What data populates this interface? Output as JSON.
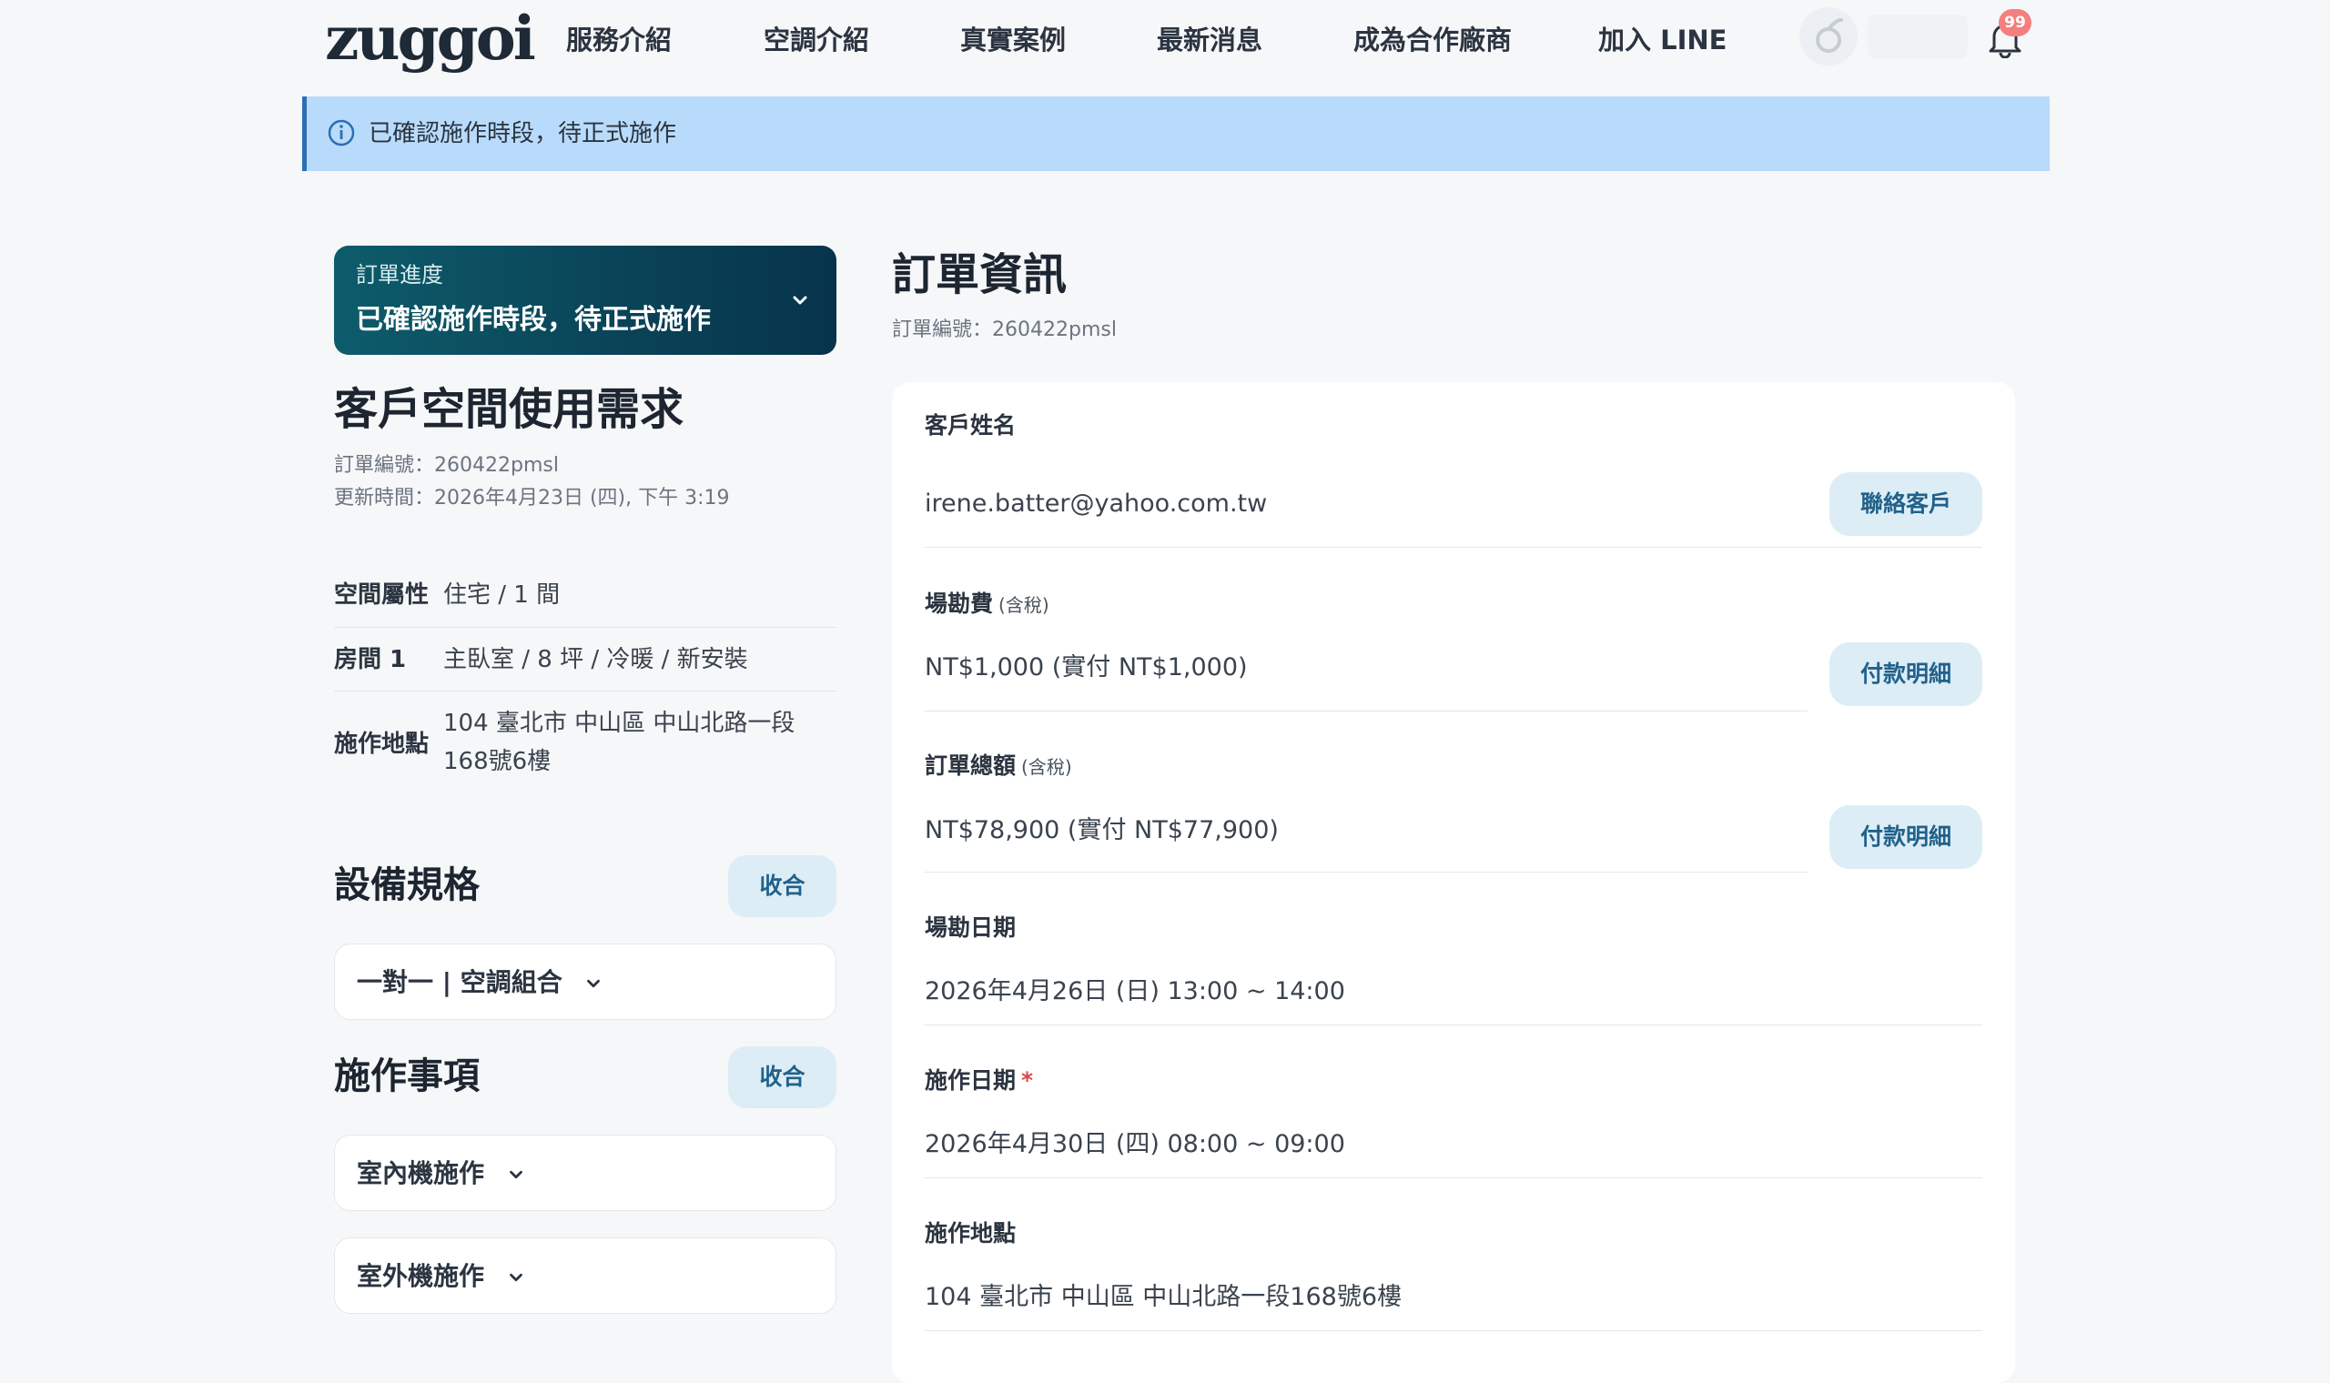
{
  "header": {
    "logo": "zuggoi",
    "nav": [
      {
        "label": "服務介紹"
      },
      {
        "label": "空調介紹"
      },
      {
        "label": "真實案例"
      },
      {
        "label": "最新消息"
      },
      {
        "label": "成為合作廠商"
      },
      {
        "label": "加入 LINE"
      }
    ],
    "notification_count": "99"
  },
  "banner": {
    "icon": "info-icon",
    "text": "已確認施作時段，待正式施作"
  },
  "progress": {
    "label": "訂單進度",
    "status": "已確認施作時段，待正式施作"
  },
  "space": {
    "title": "客戶空間使用需求",
    "order_no": "訂單編號：260422pmsl",
    "updated": "更新時間：2026年4月23日 (四), 下午 3:19",
    "rows": [
      {
        "key": "空間屬性",
        "value": "住宅 / 1 間"
      },
      {
        "key": "房間 1",
        "value": "主臥室 / 8 坪 / 冷暖 / 新安裝"
      },
      {
        "key": "施作地點",
        "value": "104 臺北市 中山區 中山北路一段168號6樓"
      }
    ]
  },
  "equipment": {
    "title": "設備規格",
    "collapse_label": "收合",
    "items": [
      {
        "label": "一對一 | 空調組合"
      }
    ]
  },
  "work": {
    "title": "施作事項",
    "collapse_label": "收合",
    "items": [
      {
        "label": "室內機施作"
      },
      {
        "label": "室外機施作"
      }
    ]
  },
  "order": {
    "title": "訂單資訊",
    "order_no": "訂單編號：260422pmsl",
    "fields": {
      "customer": {
        "label": "客戶姓名",
        "value": "irene.batter@yahoo.com.tw",
        "button": "聯絡客戶"
      },
      "survey_fee": {
        "label": "場勘費",
        "tax": "(含稅)",
        "value": "NT$1,000 (實付 NT$1,000)",
        "button": "付款明細"
      },
      "total": {
        "label": "訂單總額",
        "tax": "(含稅)",
        "value": "NT$78,900 (實付 NT$77,900)",
        "button": "付款明細"
      },
      "survey_date": {
        "label": "場勘日期",
        "value": "2026年4月26日 (日) 13:00 ~ 14:00"
      },
      "work_date": {
        "label": "施作日期",
        "required_mark": "*",
        "value": "2026年4月30日 (四) 08:00 ~ 09:00"
      },
      "work_location": {
        "label": "施作地點",
        "value": "104 臺北市 中山區 中山北路一段168號6樓"
      }
    }
  }
}
